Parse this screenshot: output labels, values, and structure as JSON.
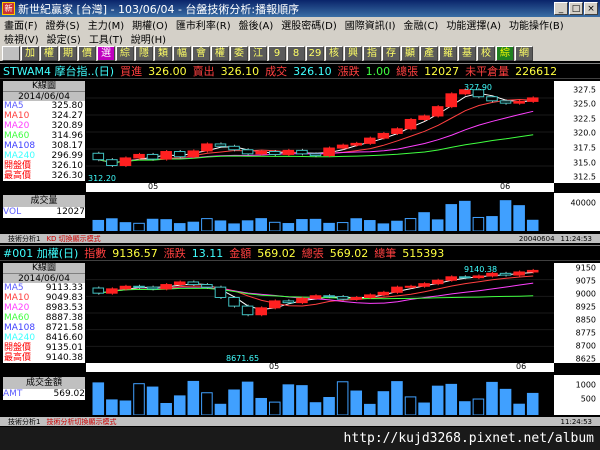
{
  "window": {
    "title": "新世紀贏家 [台灣] - 103/06/04 - 台盤技術分析:播報順序",
    "icon": "app-icon",
    "buttons": [
      "_",
      "□",
      "×"
    ]
  },
  "menu_main": [
    "畫面(F)",
    "證券(S)",
    "主力(M)",
    "期權(O)",
    "匯市利率(R)",
    "盤後(A)",
    "選股密碼(D)",
    "國際資訊(I)",
    "金融(C)",
    "功能選擇(A)",
    "功能操作(B)"
  ],
  "menu_second": [
    "檢視(V)",
    "設定(S)",
    "工具(T)",
    "說明(H)"
  ],
  "toolbar": [
    "",
    "加",
    "權",
    "期",
    "價",
    "選",
    "綜",
    "隱",
    "類",
    "幅",
    "會",
    "權",
    "委",
    "江",
    "9",
    "8",
    "29",
    "核",
    "興",
    "指",
    "存",
    "顯",
    "產",
    "羅",
    "基",
    "校",
    "綜",
    "網"
  ],
  "panel1": {
    "symbol": "STWAM4 摩台指..(日)",
    "buy_label": "買進",
    "buy_value": "326.00",
    "sell_label": "賣出",
    "sell_value": "326.10",
    "deal_label": "成交",
    "deal_value": "326.10",
    "change_label": "漲跌",
    "change_value": "1.00",
    "volume_label": "總張",
    "volume_value": "12027",
    "oi_label": "未平倉量",
    "oi_value": "226612",
    "legend_title": "K線圖",
    "legend_date": "2014/06/04",
    "ma": [
      {
        "k": "MA5",
        "v": "325.80",
        "color": "#ffffff"
      },
      {
        "k": "MA10",
        "v": "324.27",
        "color": "#ff4040"
      },
      {
        "k": "MA20",
        "v": "320.89",
        "color": "#ff40ff"
      },
      {
        "k": "MA60",
        "v": "314.96",
        "color": "#40ff40"
      },
      {
        "k": "MA108",
        "v": "308.17",
        "color": "#4040ff"
      },
      {
        "k": "MA240",
        "v": "296.99",
        "color": "#40ffff"
      },
      {
        "k": "開盤價",
        "v": "326.10",
        "color": "#ff0000"
      },
      {
        "k": "最高價",
        "v": "326.30",
        "color": "#ff0000"
      }
    ],
    "high_label": "327.90",
    "low_label": "312.20",
    "yticks": [
      "327.5",
      "325.0",
      "322.5",
      "320.0",
      "317.5",
      "315.0",
      "312.5"
    ],
    "xticks": [
      "05",
      "06"
    ],
    "vol_title": "成交量",
    "vol_key": "VOL",
    "vol_value": "12027",
    "vol_ytick": "40000",
    "status_left": "技術分析1",
    "status_mid": "KD 切換顯示模式",
    "status_right1": "20040604",
    "status_right2": "11:24:53"
  },
  "panel2": {
    "symbol": "#001 加權(日)",
    "index_label": "指數",
    "index_value": "9136.57",
    "change_label": "漲跌",
    "change_value": "13.11",
    "amount_label": "金額",
    "amount_value": "569.02",
    "vol_label": "總張",
    "vol_value": "569.02",
    "count_label": "總筆",
    "count_value": "515393",
    "legend_title": "K線圖",
    "legend_date": "2014/06/04",
    "ma": [
      {
        "k": "MA5",
        "v": "9113.33",
        "color": "#ffffff"
      },
      {
        "k": "MA10",
        "v": "9049.83",
        "color": "#ff4040"
      },
      {
        "k": "MA20",
        "v": "8983.53",
        "color": "#ff40ff"
      },
      {
        "k": "MA60",
        "v": "8887.38",
        "color": "#40ff40"
      },
      {
        "k": "MA108",
        "v": "8721.58",
        "color": "#4040ff"
      },
      {
        "k": "MA240",
        "v": "8416.60",
        "color": "#40ffff"
      },
      {
        "k": "開盤價",
        "v": "9135.01",
        "color": "#ff0000"
      },
      {
        "k": "最高價",
        "v": "9140.38",
        "color": "#ff0000"
      }
    ],
    "high_label": "9140.38",
    "low_label": "8671.65",
    "yticks": [
      "9150",
      "9075",
      "9000",
      "8925",
      "8850",
      "8775",
      "8700",
      "8625"
    ],
    "xticks": [
      "05",
      "06"
    ],
    "vol_title": "成交金額",
    "vol_key": "AMT",
    "vol_yticks": [
      "1000",
      "500"
    ],
    "status_left": "技術分析1",
    "status_mid": "技術分析切換顯示模式",
    "status_right1": "",
    "status_right2": "11:24:53"
  },
  "url": "http://kujd3268.pixnet.net/album",
  "chart_data": [
    {
      "type": "candlestick",
      "title": "STWAM4 摩台指..(日)",
      "x": [
        "05",
        "06"
      ],
      "ylim": [
        311.5,
        329
      ],
      "opens": [
        316.6,
        315.5,
        314.5,
        315.8,
        316.4,
        315.6,
        316.9,
        316.0,
        317.0,
        318.2,
        317.8,
        317.2,
        316.5,
        316.9,
        316.4,
        317.1,
        316.5,
        316.2,
        317.5,
        318.0,
        318.3,
        319.2,
        320.0,
        320.8,
        322.4,
        323.0,
        324.6,
        326.8,
        327.5,
        326.3,
        325.6,
        325.2,
        325.5
      ],
      "closes": [
        315.5,
        314.5,
        315.8,
        316.4,
        315.6,
        316.9,
        316.0,
        317.0,
        318.2,
        317.8,
        317.2,
        316.5,
        316.9,
        316.4,
        317.1,
        316.5,
        316.2,
        317.5,
        318.0,
        318.3,
        319.2,
        320.0,
        320.8,
        322.4,
        323.0,
        324.6,
        326.8,
        327.5,
        326.3,
        325.6,
        325.2,
        325.5,
        326.1
      ]
    },
    {
      "type": "candlestick",
      "title": "#001 加權(日)",
      "x": [
        "05",
        "06"
      ],
      "ylim": [
        8600,
        9180
      ],
      "opens": [
        9035,
        9005,
        9030,
        9045,
        9040,
        9030,
        9055,
        9070,
        9055,
        9040,
        8980,
        8930,
        8880,
        8920,
        8960,
        8950,
        8975,
        8990,
        8985,
        8970,
        8980,
        8995,
        9010,
        9040,
        9045,
        9060,
        9080,
        9100,
        9095,
        9105,
        9120,
        9110,
        9128
      ],
      "closes": [
        9005,
        9030,
        9045,
        9040,
        9030,
        9055,
        9070,
        9055,
        9040,
        8980,
        8930,
        8880,
        8920,
        8960,
        8950,
        8975,
        8990,
        8985,
        8970,
        8980,
        8995,
        9010,
        9040,
        9045,
        9060,
        9080,
        9100,
        9095,
        9105,
        9120,
        9110,
        9128,
        9137
      ]
    }
  ]
}
